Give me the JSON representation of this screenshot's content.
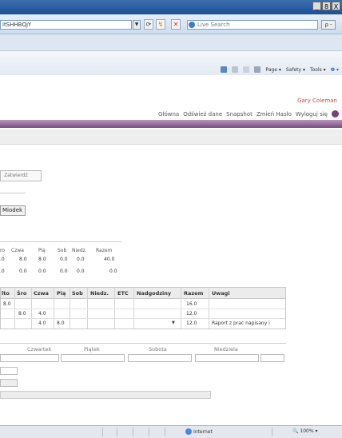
{
  "browser": {
    "address": "itSHHBQjY",
    "search_placeholder": "Live Search",
    "search_button": "ρ -",
    "window_buttons": [
      "_",
      "8",
      "X"
    ],
    "nav_icons": [
      "refresh-icon",
      "rss-icon",
      "stop-icon"
    ],
    "command_bar": [
      "Page ▾",
      "Safety ▾",
      "Tools ▾",
      "❷ ▾"
    ],
    "status_zone": "Internet",
    "status_zoom": "100%"
  },
  "app": {
    "user": "Gary Coleman",
    "nav": [
      "Główna",
      "Odśwież dane",
      "Snapshot",
      "Zmień Hasło",
      "Wyloguj się"
    ],
    "approve_button": "Zatwierdź",
    "name_field": "Miodek"
  },
  "summary": {
    "headers": [
      "ro",
      "Czwa",
      "Pią",
      "Sob",
      "Niedz.",
      "Razem"
    ],
    "rows": [
      [
        ".0",
        "8.0",
        "8.0",
        "0.0",
        "0.0",
        "40.0"
      ],
      [
        ".0",
        "0.0",
        "0.0",
        "0.0",
        "0.0",
        "0.0"
      ]
    ]
  },
  "detail": {
    "headers": [
      "lto",
      "Śro",
      "Czwa",
      "Pią",
      "Sob",
      "Niedz.",
      "ETC",
      "Nadgodziny",
      "Razem",
      "Uwagi"
    ],
    "rows": [
      {
        "c0": "8.0",
        "c1": "",
        "c2": "",
        "c3": "",
        "razem": "16.0",
        "uwagi": ""
      },
      {
        "c0": "",
        "c1": "8.0",
        "c2": "4.0",
        "c3": "",
        "razem": "12.0",
        "uwagi": ""
      },
      {
        "c0": "",
        "c1": "",
        "c2": "4.0",
        "c3": "8.0",
        "razem": "12.0",
        "uwagi": "Raport z prac napisany i"
      }
    ]
  },
  "days": [
    "Czwartek",
    "Piątek",
    "Sobota",
    "Niedziela"
  ]
}
